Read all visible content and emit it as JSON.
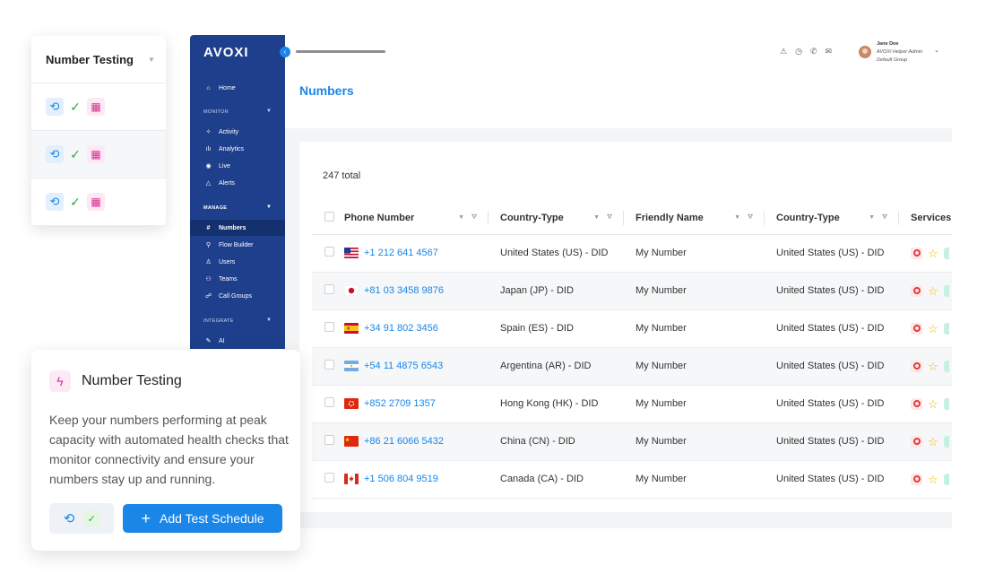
{
  "app": {
    "logo": "AVOXI",
    "page_title": "Numbers",
    "user": {
      "name": "Jane Doe",
      "role": "AVOXI Helper Admin",
      "group": "Default Group"
    }
  },
  "sidebar": {
    "home": {
      "label": "Home",
      "icon": "home-icon"
    },
    "sections": [
      {
        "label": "MONITOR",
        "items": [
          {
            "label": "Activity",
            "icon": "activity-icon"
          },
          {
            "label": "Analytics",
            "icon": "analytics-icon"
          },
          {
            "label": "Live",
            "icon": "live-icon"
          },
          {
            "label": "Alerts",
            "icon": "alert-icon"
          }
        ]
      },
      {
        "label": "MANAGE",
        "items": [
          {
            "label": "Numbers",
            "icon": "numbers-icon",
            "active": true
          },
          {
            "label": "Flow Builder",
            "icon": "flow-builder-icon"
          },
          {
            "label": "Users",
            "icon": "user-icon"
          },
          {
            "label": "Teams",
            "icon": "teams-icon"
          },
          {
            "label": "Call Groups",
            "icon": "call-groups-icon"
          }
        ]
      },
      {
        "label": "INTEGRATE",
        "items": [
          {
            "label": "AI",
            "icon": "ai-icon"
          }
        ]
      }
    ]
  },
  "table": {
    "total": "247 total",
    "columns": [
      "Phone Number",
      "Country-Type",
      "Friendly Name",
      "Country-Type",
      "Services E"
    ],
    "rows": [
      {
        "flag": "us",
        "phone": "+1 212 641 4567",
        "country_type": "United States (US) - DID",
        "friendly": "My Number",
        "country_type2": "United States (US) - DID"
      },
      {
        "flag": "jp",
        "phone": "+81 03 3458 9876",
        "country_type": "Japan (JP) - DID",
        "friendly": "My Number",
        "country_type2": "United States (US) - DID"
      },
      {
        "flag": "es",
        "phone": "+34 91 802 3456",
        "country_type": "Spain (ES) - DID",
        "friendly": "My Number",
        "country_type2": "United States (US) - DID"
      },
      {
        "flag": "ar",
        "phone": "+54 11 4875 6543",
        "country_type": "Argentina (AR) - DID",
        "friendly": "My Number",
        "country_type2": "United States (US) - DID"
      },
      {
        "flag": "hk",
        "phone": "+852 2709 1357",
        "country_type": "Hong Kong (HK) - DID",
        "friendly": "My Number",
        "country_type2": "United States (US) - DID"
      },
      {
        "flag": "cn",
        "phone": "+86 21 6066 5432",
        "country_type": "China (CN) - DID",
        "friendly": "My Number",
        "country_type2": "United States (US) - DID"
      },
      {
        "flag": "ca",
        "phone": "+1 506 804 9519",
        "country_type": "Canada (CA) - DID",
        "friendly": "My Number",
        "country_type2": "United States (US) - DID"
      }
    ]
  },
  "number_testing_list": {
    "title": "Number Testing",
    "rows": 3
  },
  "number_testing_card": {
    "title": "Number Testing",
    "description": "Keep your numbers performing at peak capacity with automated health checks that monitor connectivity and ensure your numbers stay up and running.",
    "button_label": "Add Test Schedule"
  },
  "colors": {
    "sidebar": "#1e3f8c",
    "accent": "#1a86e8",
    "success": "#2daa3c",
    "pink": "#d3308e"
  }
}
